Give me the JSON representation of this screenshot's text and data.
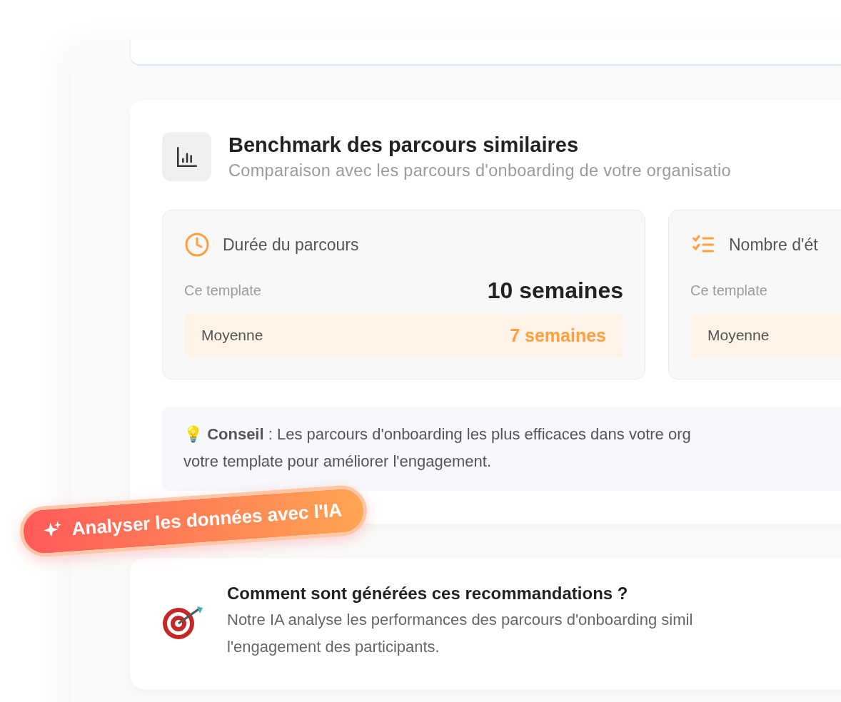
{
  "benchmark": {
    "title": "Benchmark des parcours similaires",
    "subtitle": "Comparaison avec les parcours d'onboarding de votre organisatio",
    "stats": [
      {
        "kind": "duration",
        "title": "Durée du parcours",
        "template_label": "Ce template",
        "template_value": "10 semaines",
        "average_label": "Moyenne",
        "average_value": "7 semaines"
      },
      {
        "kind": "steps",
        "title": "Nombre d'ét",
        "template_label": "Ce template",
        "average_label": "Moyenne"
      }
    ],
    "tip": {
      "icon": "💡",
      "text": "**Conseil** : Les parcours d'onboarding les plus efficaces dans votre org\nvotre template pour améliorer l'engagement."
    }
  },
  "ai_button": {
    "label": "Analyser les données avec l'IA"
  },
  "info": {
    "title": "Comment sont générées ces recommandations ?",
    "text": "Notre IA analyse les performances des parcours d'onboarding simil\nl'engagement des participants."
  }
}
